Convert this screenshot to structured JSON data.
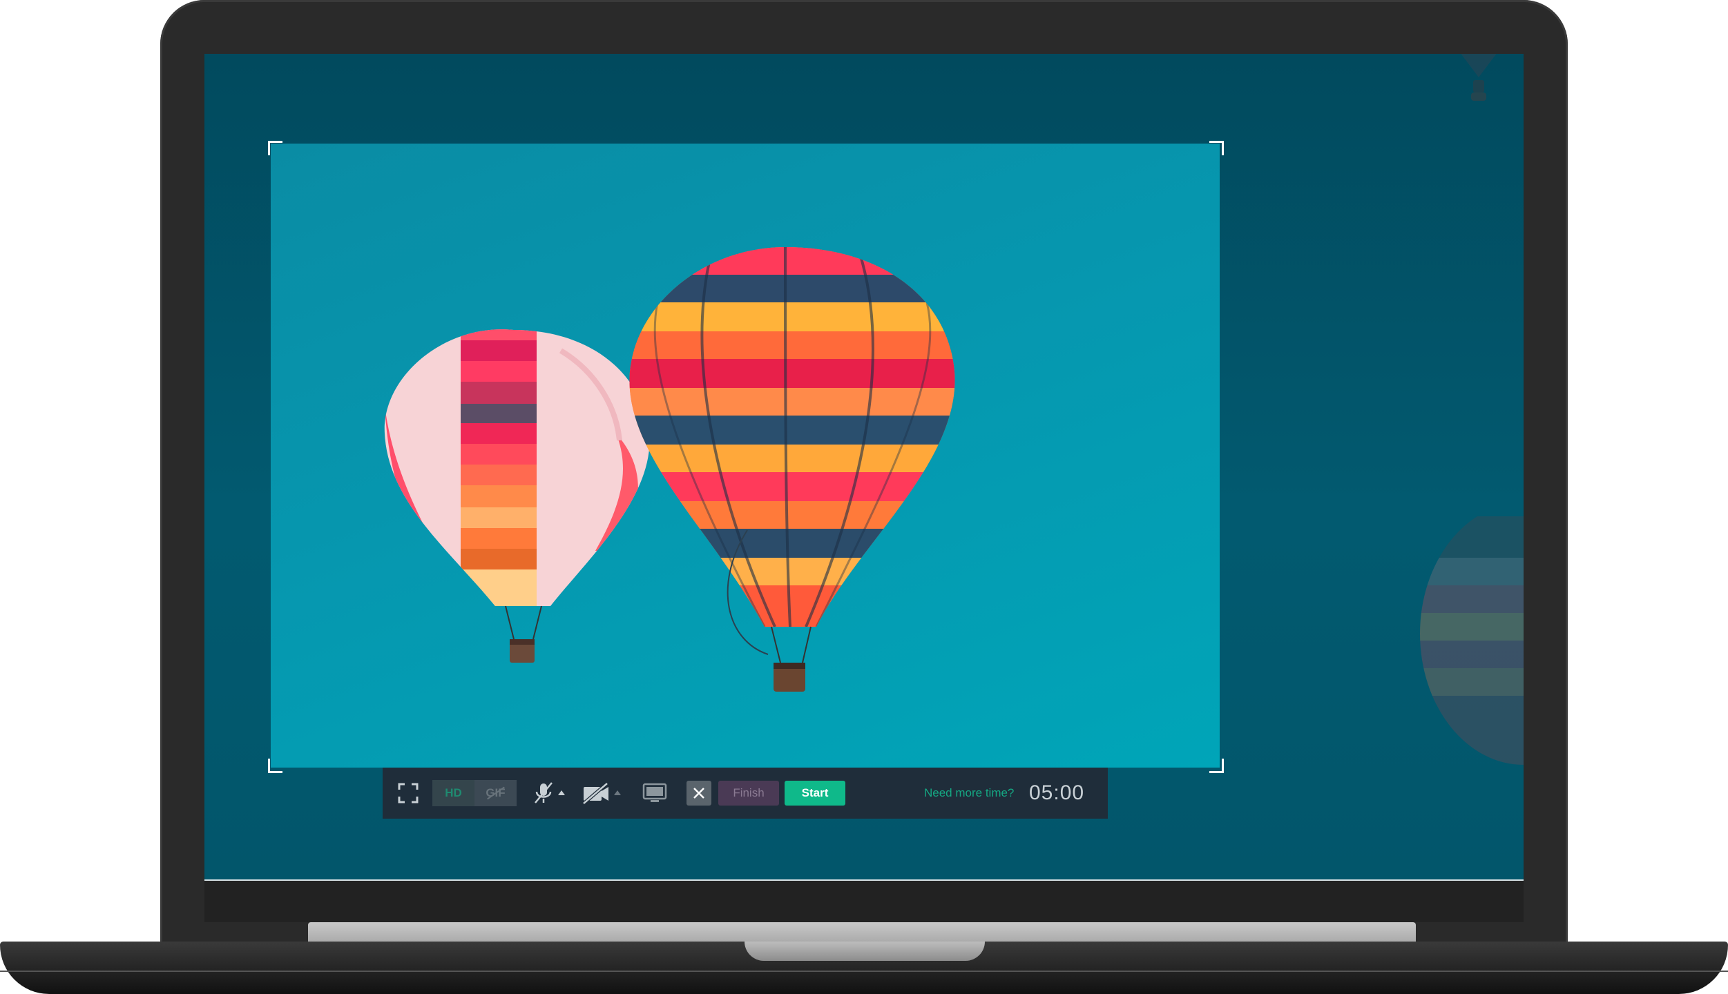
{
  "toolbar": {
    "fullscreen_icon": "fullscreen-icon",
    "quality": {
      "hd_label": "HD",
      "gif_label": "GIF"
    },
    "microphone_icon": "mic-muted-icon",
    "camera_icon": "camera-off-icon",
    "screen_icon": "monitor-icon",
    "cancel_icon": "close-icon",
    "finish_label": "Finish",
    "start_label": "Start",
    "need_more_time": "Need more time?",
    "timer": "05:00"
  },
  "colors": {
    "screen_bg": "#025a70",
    "capture_bg": "#0697af",
    "toolbar_bg": "#1f2d3a",
    "start_button": "#0fb98a",
    "finish_button": "#4a3a55",
    "accent_text": "#15a883"
  }
}
